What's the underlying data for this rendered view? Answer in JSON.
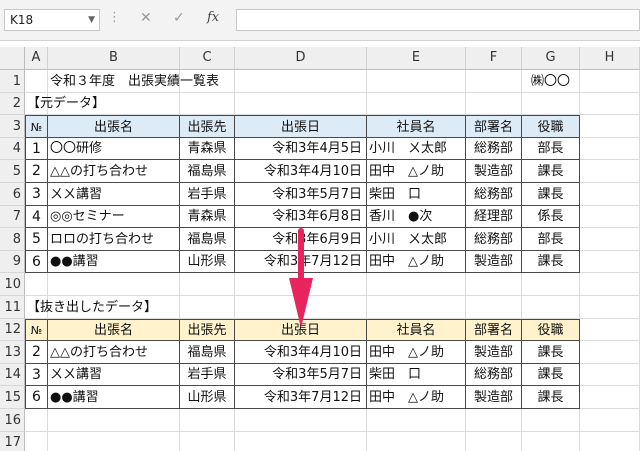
{
  "formula_bar": {
    "name_box": "K18",
    "fx": "fx",
    "cancel": "✕",
    "enter": "✓",
    "formula": ""
  },
  "columns": [
    "A",
    "B",
    "C",
    "D",
    "E",
    "F",
    "G",
    "H"
  ],
  "rows": [
    "1",
    "2",
    "3",
    "4",
    "5",
    "6",
    "7",
    "8",
    "9",
    "10",
    "11",
    "12",
    "13",
    "14",
    "15",
    "16",
    "17"
  ],
  "sheet": {
    "title": "令和３年度　出張実績一覧表",
    "company": "㈱〇〇",
    "section1": "【元データ】",
    "section2": "【抜き出したデータ】",
    "headers": [
      "№",
      "出張名",
      "出張先",
      "出張日",
      "社員名",
      "部署名",
      "役職"
    ],
    "source_rows": [
      [
        "1",
        "〇〇研修",
        "青森県",
        "令和3年4月5日",
        "小川　ㄨ太郎",
        "総務部",
        "部長"
      ],
      [
        "2",
        "△△の打ち合わせ",
        "福島県",
        "令和3年4月10日",
        "田中　△ノ助",
        "製造部",
        "課長"
      ],
      [
        "3",
        "ㄨㄨ講習",
        "岩手県",
        "令和3年5月7日",
        "柴田　口",
        "総務部",
        "課長"
      ],
      [
        "4",
        "◎◎セミナー",
        "青森県",
        "令和3年6月8日",
        "香川　●次",
        "経理部",
        "係長"
      ],
      [
        "5",
        "ロロの打ち合わせ",
        "福島県",
        "令和3年6月9日",
        "小川　ㄨ太郎",
        "総務部",
        "部長"
      ],
      [
        "6",
        "●●講習",
        "山形県",
        "令和3年7月12日",
        "田中　△ノ助",
        "製造部",
        "課長"
      ]
    ],
    "extracted_rows": [
      [
        "2",
        "△△の打ち合わせ",
        "福島県",
        "令和3年4月10日",
        "田中　△ノ助",
        "製造部",
        "課長"
      ],
      [
        "3",
        "ㄨㄨ講習",
        "岩手県",
        "令和3年5月7日",
        "柴田　口",
        "総務部",
        "課長"
      ],
      [
        "6",
        "●●講習",
        "山形県",
        "令和3年7月12日",
        "田中　△ノ助",
        "製造部",
        "課長"
      ]
    ]
  },
  "colors": {
    "header_blue": "#ddebf7",
    "header_yellow": "#fff2cc",
    "arrow": "#e8245e"
  }
}
